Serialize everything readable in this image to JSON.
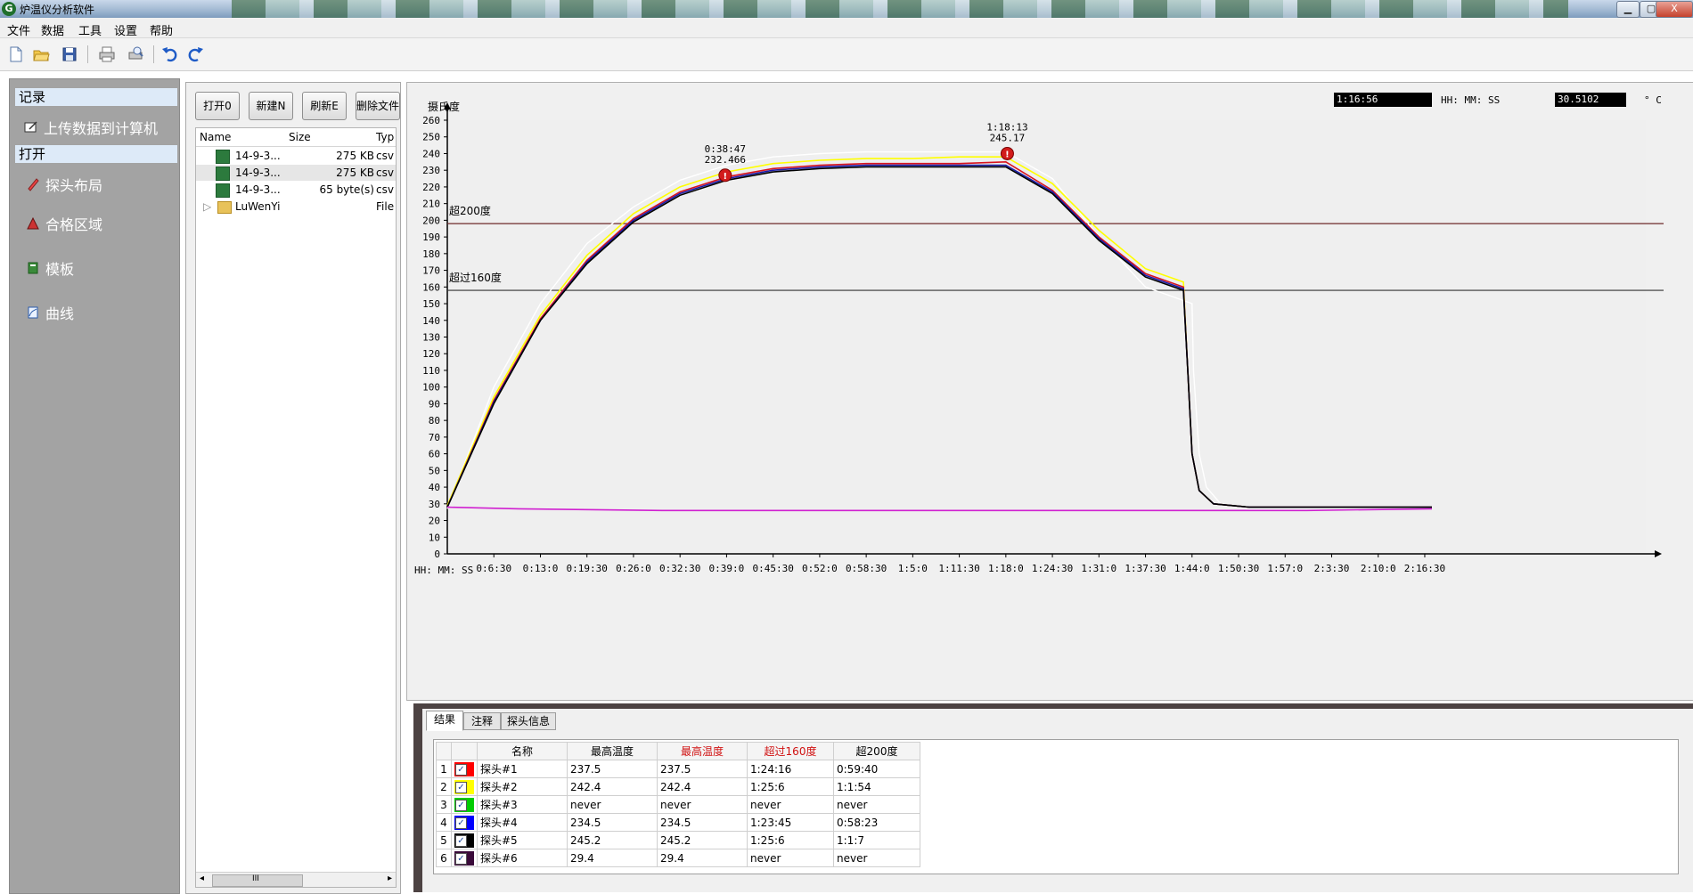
{
  "window": {
    "title": "炉温仪分析软件",
    "min_label": "▁",
    "max_label": "▢",
    "close_label": "X"
  },
  "menu": [
    "文件",
    "数据",
    "工具",
    "设置",
    "帮助"
  ],
  "toolbar": {
    "items": [
      "new-file-icon",
      "open-folder-icon",
      "save-icon",
      "print-icon",
      "print-preview-icon",
      "undo-icon",
      "redo-icon"
    ]
  },
  "nav": {
    "section_record": "记录",
    "upload_label": "上传数据到计算机",
    "section_open": "打开",
    "items": [
      "探头布局",
      "合格区域",
      "模板",
      "曲线"
    ]
  },
  "file_panel": {
    "buttons": [
      "打开0",
      "新建N",
      "刷新E",
      "删除文件"
    ],
    "columns": [
      "Name",
      "Size",
      "Typ"
    ],
    "rows": [
      {
        "name": "14-9-3...",
        "size": "275 KB",
        "type": "csv",
        "icon": "csv-file-icon"
      },
      {
        "name": "14-9-3...",
        "size": "275 KB",
        "type": "csv",
        "icon": "csv-file-icon"
      },
      {
        "name": "14-9-3...",
        "size": "65 byte(s)",
        "type": "csv",
        "icon": "csv-file-icon"
      },
      {
        "name": "LuWenYi",
        "size": "",
        "type": "File",
        "icon": "folder-icon"
      }
    ],
    "scroll_left": "◂",
    "scroll_right": "▸",
    "scroll_grip": "III"
  },
  "chart_readout": {
    "time_value": "1:16:56",
    "time_label": "HH: MM: SS",
    "temp_value": "30.5102",
    "temp_unit": "° C"
  },
  "chart_data": {
    "type": "line",
    "ylabel": "摄氏度",
    "xlabel": "HH: MM: SS",
    "ylim": [
      0,
      260
    ],
    "yticks": [
      0,
      10,
      20,
      30,
      40,
      50,
      60,
      70,
      80,
      90,
      100,
      110,
      120,
      130,
      140,
      150,
      160,
      170,
      180,
      190,
      200,
      210,
      220,
      230,
      240,
      250,
      260
    ],
    "xticks": [
      "0:6:30",
      "0:13:0",
      "0:19:30",
      "0:26:0",
      "0:32:30",
      "0:39:0",
      "0:45:30",
      "0:52:0",
      "0:58:30",
      "1:5:0",
      "1:11:30",
      "1:18:0",
      "1:24:30",
      "1:31:0",
      "1:37:30",
      "1:44:0",
      "1:50:30",
      "1:57:0",
      "2:3:30",
      "2:10:0",
      "2:16:30"
    ],
    "xtick_minutes": [
      6.5,
      13,
      19.5,
      26,
      32.5,
      39,
      45.5,
      52,
      58.5,
      65,
      71.5,
      78,
      84.5,
      91,
      97.5,
      104,
      110.5,
      117,
      123.5,
      130,
      136.5
    ],
    "xlim_minutes": [
      0,
      137.5
    ],
    "thresholds": [
      {
        "label": "超200度",
        "value": 198,
        "color": "#6e2a2a"
      },
      {
        "label": "超过160度",
        "value": 158,
        "color": "#333333"
      }
    ],
    "markers": [
      {
        "time": "0:38:47",
        "value": "232.466",
        "x": 38.8,
        "y": 227
      },
      {
        "time": "1:18:13",
        "value": "245.17",
        "x": 78.2,
        "y": 240
      }
    ],
    "series": [
      {
        "color": "#ffffff",
        "points": [
          [
            0,
            27
          ],
          [
            6.5,
            100
          ],
          [
            13,
            150
          ],
          [
            19.5,
            186
          ],
          [
            26,
            208
          ],
          [
            32.5,
            224
          ],
          [
            39,
            233
          ],
          [
            45.5,
            238
          ],
          [
            52,
            240
          ],
          [
            58.5,
            241
          ],
          [
            65,
            241
          ],
          [
            71.5,
            241
          ],
          [
            78,
            241
          ],
          [
            84.5,
            225
          ],
          [
            91,
            190
          ],
          [
            97.5,
            160
          ],
          [
            104,
            150
          ],
          [
            104.2,
            110
          ],
          [
            105,
            60
          ],
          [
            106,
            40
          ],
          [
            108,
            30
          ],
          [
            112,
            27
          ],
          [
            137.5,
            27
          ]
        ]
      },
      {
        "color": "#ffff00",
        "points": [
          [
            0,
            29
          ],
          [
            6.5,
            94
          ],
          [
            13,
            143
          ],
          [
            19.5,
            179
          ],
          [
            26,
            204
          ],
          [
            32.5,
            220
          ],
          [
            39,
            229
          ],
          [
            45.5,
            234
          ],
          [
            52,
            236
          ],
          [
            58.5,
            237
          ],
          [
            65,
            237
          ],
          [
            71.5,
            238
          ],
          [
            78,
            238
          ],
          [
            84.5,
            222
          ],
          [
            91,
            194
          ],
          [
            97.5,
            171
          ],
          [
            102.8,
            163
          ],
          [
            103.4,
            110
          ],
          [
            104,
            60
          ],
          [
            105,
            38
          ],
          [
            107,
            30
          ],
          [
            112,
            28
          ],
          [
            137.5,
            28
          ]
        ]
      },
      {
        "color": "#d8141e",
        "points": [
          [
            0,
            28
          ],
          [
            6.5,
            92
          ],
          [
            13,
            141
          ],
          [
            19.5,
            176
          ],
          [
            26,
            201
          ],
          [
            32.5,
            217
          ],
          [
            39,
            226
          ],
          [
            45.5,
            231
          ],
          [
            52,
            233
          ],
          [
            58.5,
            234
          ],
          [
            65,
            234
          ],
          [
            71.5,
            234
          ],
          [
            78,
            235
          ],
          [
            84.5,
            218
          ],
          [
            91,
            190
          ],
          [
            97.5,
            168
          ],
          [
            102.8,
            160
          ],
          [
            103.4,
            110
          ],
          [
            104,
            60
          ],
          [
            105,
            38
          ],
          [
            107,
            30
          ],
          [
            112,
            28
          ],
          [
            137.5,
            28
          ]
        ]
      },
      {
        "color": "#1a1aa8",
        "points": [
          [
            0,
            28
          ],
          [
            6.5,
            91
          ],
          [
            13,
            140
          ],
          [
            19.5,
            175
          ],
          [
            26,
            200
          ],
          [
            32.5,
            216
          ],
          [
            39,
            225
          ],
          [
            45.5,
            230
          ],
          [
            52,
            232
          ],
          [
            58.5,
            233
          ],
          [
            65,
            233
          ],
          [
            71.5,
            233
          ],
          [
            78,
            233
          ],
          [
            84.5,
            217
          ],
          [
            91,
            189
          ],
          [
            97.5,
            167
          ],
          [
            102.8,
            159
          ],
          [
            103.4,
            110
          ],
          [
            104,
            60
          ],
          [
            105,
            38
          ],
          [
            107,
            30
          ],
          [
            112,
            28
          ],
          [
            137.5,
            28
          ]
        ]
      },
      {
        "color": "#000000",
        "points": [
          [
            0,
            28
          ],
          [
            6.5,
            90
          ],
          [
            13,
            140
          ],
          [
            19.5,
            174
          ],
          [
            26,
            199
          ],
          [
            32.5,
            215
          ],
          [
            39,
            224
          ],
          [
            45.5,
            229
          ],
          [
            52,
            231
          ],
          [
            58.5,
            232
          ],
          [
            65,
            232
          ],
          [
            71.5,
            232
          ],
          [
            78,
            232
          ],
          [
            84.5,
            216
          ],
          [
            91,
            188
          ],
          [
            97.5,
            166
          ],
          [
            102.8,
            158
          ],
          [
            103.4,
            110
          ],
          [
            104,
            60
          ],
          [
            105,
            38
          ],
          [
            107,
            30
          ],
          [
            112,
            28
          ],
          [
            137.5,
            28
          ]
        ]
      },
      {
        "color": "#d020d0",
        "points": [
          [
            0,
            28
          ],
          [
            10,
            27
          ],
          [
            30,
            26
          ],
          [
            60,
            26
          ],
          [
            90,
            26
          ],
          [
            120,
            26
          ],
          [
            137.5,
            27
          ]
        ]
      }
    ]
  },
  "results": {
    "tabs": [
      "结果",
      "注释",
      "探头信息"
    ],
    "columns": [
      "名称",
      "最高温度",
      "最高温度",
      "超过160度",
      "超200度"
    ],
    "column_colors": [
      "#000000",
      "#000000",
      "#d01010",
      "#d01010",
      "#000000"
    ],
    "rows": [
      {
        "num": "1",
        "color": "#ff0000",
        "name": "探头#1",
        "max1": "237.5",
        "max2": "237.5",
        "over160": "1:24:16",
        "over200": "0:59:40"
      },
      {
        "num": "2",
        "color": "#ffff00",
        "name": "探头#2",
        "max1": "242.4",
        "max2": "242.4",
        "over160": "1:25:6",
        "over200": "1:1:54"
      },
      {
        "num": "3",
        "color": "#00cc00",
        "name": "探头#3",
        "max1": "never",
        "max2": "never",
        "over160": "never",
        "over200": "never"
      },
      {
        "num": "4",
        "color": "#0000ff",
        "name": "探头#4",
        "max1": "234.5",
        "max2": "234.5",
        "over160": "1:23:45",
        "over200": "0:58:23"
      },
      {
        "num": "5",
        "color": "#000000",
        "name": "探头#5",
        "max1": "245.2",
        "max2": "245.2",
        "over160": "1:25:6",
        "over200": "1:1:7"
      },
      {
        "num": "6",
        "color": "#3a0a3a",
        "name": "探头#6",
        "max1": "29.4",
        "max2": "29.4",
        "over160": "never",
        "over200": "never"
      }
    ],
    "check_mark": "✓"
  }
}
